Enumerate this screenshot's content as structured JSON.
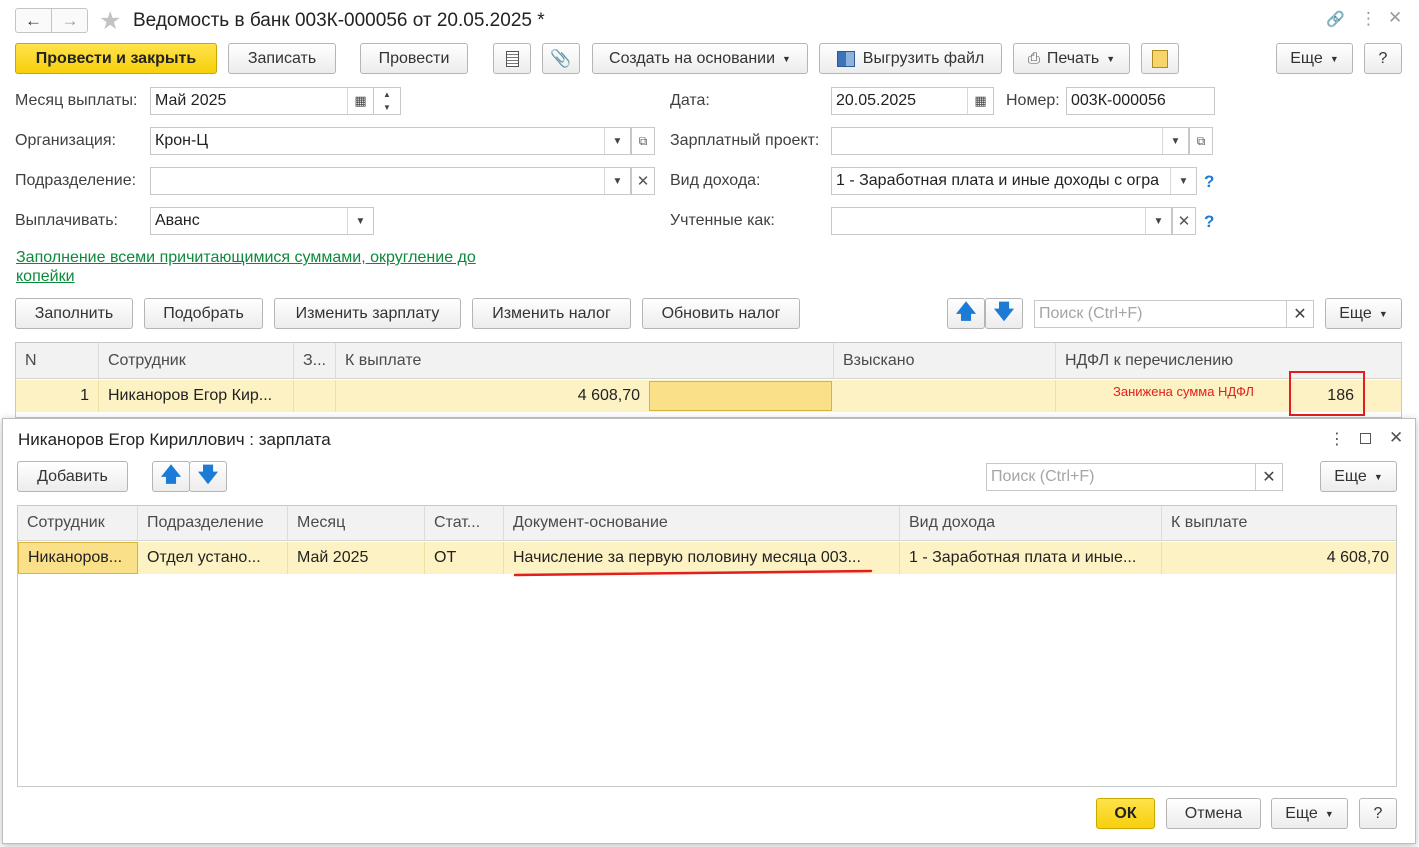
{
  "window": {
    "title": "Ведомость в банк 003К-000056 от 20.05.2025 *"
  },
  "toolbar": {
    "post_close": "Провести и закрыть",
    "save": "Записать",
    "post": "Провести",
    "create_based": "Создать на основании",
    "export_file": "Выгрузить файл",
    "print": "Печать",
    "more": "Еще",
    "help": "?"
  },
  "form": {
    "month_label": "Месяц выплаты:",
    "month_value": "Май 2025",
    "date_label": "Дата:",
    "date_value": "20.05.2025",
    "number_label": "Номер:",
    "number_value": "003К-000056",
    "org_label": "Организация:",
    "org_value": "Крон-Ц",
    "salary_project_label": "Зарплатный проект:",
    "salary_project_value": "",
    "dept_label": "Подразделение:",
    "dept_value": "",
    "income_type_label": "Вид дохода:",
    "income_type_value": "1 - Заработная плата и иные доходы с огра",
    "pay_label": "Выплачивать:",
    "pay_value": "Аванс",
    "counted_as_label": "Учтенные как:",
    "counted_as_value": "",
    "fill_link": "Заполнение всеми причитающимися суммами, округление до копейки"
  },
  "table_toolbar": {
    "fill": "Заполнить",
    "select": "Подобрать",
    "change_salary": "Изменить зарплату",
    "change_tax": "Изменить налог",
    "update_tax": "Обновить налог",
    "search_placeholder": "Поиск (Ctrl+F)",
    "more": "Еще"
  },
  "table": {
    "columns": [
      "N",
      "Сотрудник",
      "З...",
      "К выплате",
      "Взыскано",
      "НДФЛ к перечислению"
    ],
    "rows": [
      {
        "n": "1",
        "employee": "Никаноров Егор Кир...",
        "z": "",
        "to_pay": "4 608,70",
        "collected": "",
        "ndfl_warning": "Занижена сумма НДФЛ",
        "ndfl": "186"
      }
    ]
  },
  "dialog": {
    "title": "Никаноров Егор Кириллович : зарплата",
    "add": "Добавить",
    "search_placeholder": "Поиск (Ctrl+F)",
    "more": "Еще",
    "columns": [
      "Сотрудник",
      "Подразделение",
      "Месяц",
      "Стат...",
      "Документ-основание",
      "Вид дохода",
      "К выплате"
    ],
    "rows": [
      {
        "employee": "Никаноров...",
        "dept": "Отдел устано...",
        "month": "Май 2025",
        "status": "ОТ",
        "document": "Начисление за первую половину месяца 003...",
        "income_type": "1 - Заработная плата и иные...",
        "to_pay": "4 608,70"
      }
    ],
    "ok": "ОК",
    "cancel": "Отмена",
    "help": "?"
  },
  "colors": {
    "accent_yellow": "#f7cf0c",
    "row_highlight": "#fdf2c3",
    "link_green": "#0c8a3c",
    "warning_red": "#e31e1e",
    "arrow_blue": "#1c7cd5"
  }
}
